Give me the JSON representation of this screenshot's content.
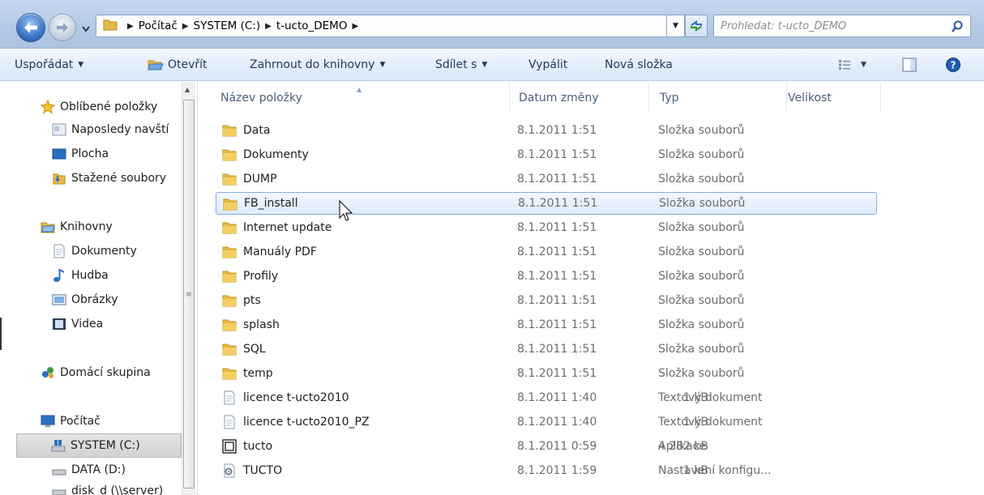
{
  "address": {
    "breadcrumbs": [
      "Počítač",
      "SYSTEM (C:)",
      "t-ucto_DEMO"
    ],
    "search_placeholder": "Prohledat: t-ucto_DEMO"
  },
  "toolbar": {
    "organize": "Uspořádat",
    "open": "Otevřít",
    "include": "Zahrnout do knihovny",
    "share": "Sdílet s",
    "burn": "Vypálit",
    "new_folder": "Nová složka"
  },
  "nav": {
    "favorites": "Oblíbené položky",
    "recent": "Naposledy navští",
    "desktop": "Plocha",
    "downloads": "Stažené soubory",
    "libraries": "Knihovny",
    "documents": "Dokumenty",
    "music": "Hudba",
    "pictures": "Obrázky",
    "videos": "Videa",
    "homegroup": "Domácí skupina",
    "computer": "Počítač",
    "system_c": "SYSTEM (C:)",
    "data_d": "DATA (D:)",
    "disk_d": "disk_d (\\\\server)"
  },
  "columns": {
    "name": "Název položky",
    "date": "Datum změny",
    "type": "Typ",
    "size": "Velikost"
  },
  "files": [
    {
      "name": "Data",
      "date": "8.1.2011 1:51",
      "type": "Složka souborů",
      "size": "",
      "icon": "folder-icon"
    },
    {
      "name": "Dokumenty",
      "date": "8.1.2011 1:51",
      "type": "Složka souborů",
      "size": "",
      "icon": "folder-icon"
    },
    {
      "name": "DUMP",
      "date": "8.1.2011 1:51",
      "type": "Složka souborů",
      "size": "",
      "icon": "folder-icon"
    },
    {
      "name": "FB_install",
      "date": "8.1.2011 1:51",
      "type": "Složka souborů",
      "size": "",
      "icon": "folder-icon"
    },
    {
      "name": "Internet update",
      "date": "8.1.2011 1:51",
      "type": "Složka souborů",
      "size": "",
      "icon": "folder-icon"
    },
    {
      "name": "Manuály PDF",
      "date": "8.1.2011 1:51",
      "type": "Složka souborů",
      "size": "",
      "icon": "folder-icon"
    },
    {
      "name": "Profily",
      "date": "8.1.2011 1:51",
      "type": "Složka souborů",
      "size": "",
      "icon": "folder-icon"
    },
    {
      "name": "pts",
      "date": "8.1.2011 1:51",
      "type": "Složka souborů",
      "size": "",
      "icon": "folder-icon"
    },
    {
      "name": "splash",
      "date": "8.1.2011 1:51",
      "type": "Složka souborů",
      "size": "",
      "icon": "folder-icon"
    },
    {
      "name": "SQL",
      "date": "8.1.2011 1:51",
      "type": "Složka souborů",
      "size": "",
      "icon": "folder-icon"
    },
    {
      "name": "temp",
      "date": "8.1.2011 1:51",
      "type": "Složka souborů",
      "size": "",
      "icon": "folder-icon"
    },
    {
      "name": "licence t-ucto2010",
      "date": "8.1.2011 1:40",
      "type": "Textový dokument",
      "size": "1 kB",
      "icon": "text-file-icon"
    },
    {
      "name": "licence t-ucto2010_PZ",
      "date": "8.1.2011 1:40",
      "type": "Textový dokument",
      "size": "1 kB",
      "icon": "text-file-icon"
    },
    {
      "name": "tucto",
      "date": "8.1.2011 0:59",
      "type": "Aplikace",
      "size": "4 282 kB",
      "icon": "application-icon"
    },
    {
      "name": "TUCTO",
      "date": "8.1.2011 1:59",
      "type": "Nastavení konfigu...",
      "size": "1 kB",
      "icon": "config-file-icon"
    }
  ],
  "colors": {
    "selection_border": "#84acdd",
    "folder_yellow": "#e8b944"
  }
}
